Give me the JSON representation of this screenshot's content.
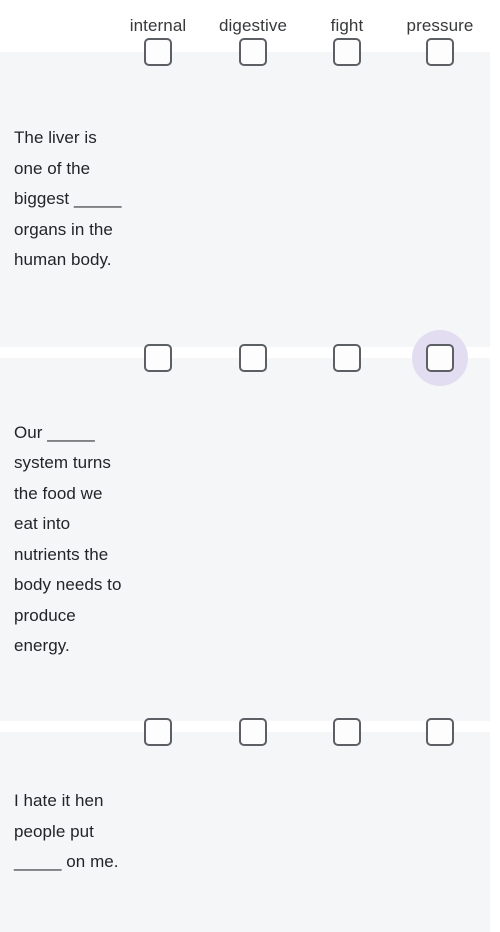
{
  "widget": {
    "type": "multiple-choice-grid",
    "background_color": "#ffffff",
    "row_background_color": "#f5f6f8",
    "focus_ring_color": "#e2ddf0",
    "checkbox_border_color": "#5c6065"
  },
  "header": {
    "columns": [
      {
        "label": "internal"
      },
      {
        "label": "digestive"
      },
      {
        "label": "fight"
      },
      {
        "label": "pressure"
      }
    ]
  },
  "rows": [
    {
      "question": "The liver is one of the biggest _____ organs in the human body.",
      "cells": [
        {
          "checked": false,
          "focused": false
        },
        {
          "checked": false,
          "focused": false
        },
        {
          "checked": false,
          "focused": false
        },
        {
          "checked": false,
          "focused": false
        }
      ]
    },
    {
      "question": "Our _____ system turns the food we eat into nutrients the body needs to produce energy.",
      "cells": [
        {
          "checked": false,
          "focused": false
        },
        {
          "checked": false,
          "focused": false
        },
        {
          "checked": false,
          "focused": false
        },
        {
          "checked": false,
          "focused": true
        }
      ]
    },
    {
      "question": "I hate it hen people put _____ on me.",
      "cells": [
        {
          "checked": false,
          "focused": false
        },
        {
          "checked": false,
          "focused": false
        },
        {
          "checked": false,
          "focused": false
        },
        {
          "checked": false,
          "focused": false
        }
      ]
    }
  ]
}
